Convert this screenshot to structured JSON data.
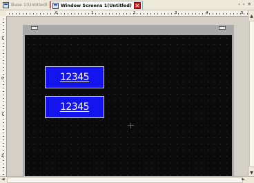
{
  "tabs": [
    {
      "label": "Base 1(Untitled)",
      "active": false
    },
    {
      "label": "Window Screens 1(Untitled)",
      "active": true
    }
  ],
  "tab_scroll_arrows": "‹ › ✕",
  "rulers": {
    "horizontal": [
      "0",
      "1",
      "2",
      "3",
      "4",
      "5"
    ],
    "vertical": [
      "1",
      "0",
      "1",
      "2"
    ]
  },
  "displays": [
    {
      "value": "12345"
    },
    {
      "value": "12345"
    }
  ],
  "colors": {
    "display_fill": "#1414ee",
    "work_area": "#0b0b0b",
    "close_button": "#d02020"
  },
  "icons": [
    "screen-icon",
    "close-icon",
    "crosshair-icon"
  ]
}
